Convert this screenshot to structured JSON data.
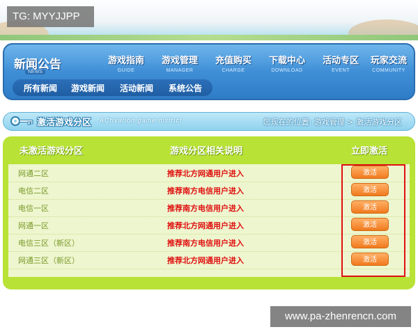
{
  "tg_label": "TG: MYYJJPP",
  "watermark": "www.pa-zhenrencn.com",
  "nav": {
    "logo": "新闻公告",
    "logo_sub": "NEWS",
    "items": [
      {
        "cn": "游戏指南",
        "en": "GUIDE"
      },
      {
        "cn": "游戏管理",
        "en": "MANAGER"
      },
      {
        "cn": "充值购买",
        "en": "CHARGE"
      },
      {
        "cn": "下载中心",
        "en": "DOWNLOAD"
      },
      {
        "cn": "活动专区",
        "en": "EVENT"
      },
      {
        "cn": "玩家交流",
        "en": "COMMUNITY"
      }
    ],
    "subnav": [
      "所有新闻",
      "游戏新闻",
      "活动新闻",
      "系统公告"
    ]
  },
  "titlebar": {
    "title_cn": "激活游戏分区",
    "title_en": "ACtivation game district",
    "breadcrumb": "您现在的位置: 游戏管理 > 激活游戏分区"
  },
  "table": {
    "headers": [
      "未激活游戏分区",
      "游戏分区相关说明",
      "立即激活"
    ],
    "rows": [
      {
        "zone": "网通二区",
        "desc": "推荐北方网通用户进入",
        "button": "激活"
      },
      {
        "zone": "电信二区",
        "desc": "推荐南方电信用户进入",
        "button": "激活"
      },
      {
        "zone": "电信一区",
        "desc": "推荐南方电信用户进入",
        "button": "激活"
      },
      {
        "zone": "网通一区",
        "desc": "推荐北方网通用户进入",
        "button": "激活"
      },
      {
        "zone": "电信三区（新区）",
        "desc": "推荐南方电信用户进入",
        "button": "激活"
      },
      {
        "zone": "网通三区（新区）",
        "desc": "推荐北方网通用户进入",
        "button": "激活"
      }
    ]
  },
  "colors": {
    "nav_blue": "#3f8fd6",
    "panel_green": "#b8e236",
    "button_orange": "#f07a1e",
    "desc_red": "#e01010",
    "highlight_red": "#e01010"
  }
}
